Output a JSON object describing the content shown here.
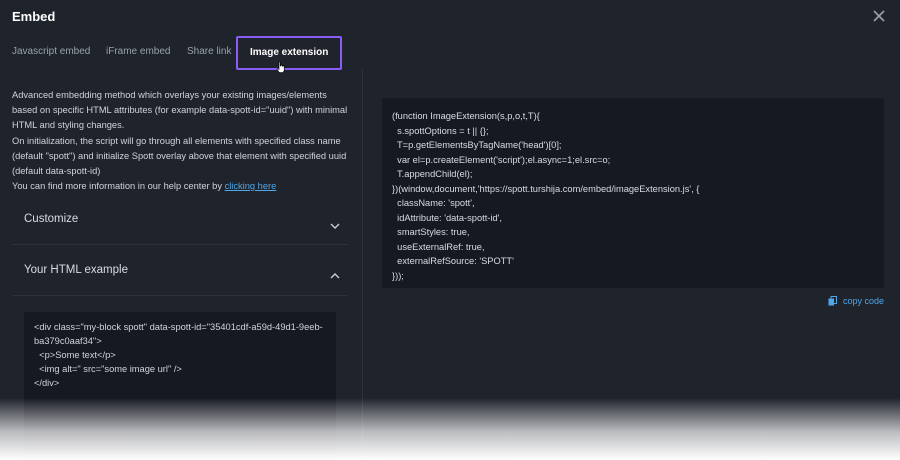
{
  "dialog": {
    "title": "Embed"
  },
  "tabs": [
    {
      "label": "Javascript embed"
    },
    {
      "label": "iFrame embed"
    },
    {
      "label": "Share link"
    },
    {
      "label": "Image extension"
    }
  ],
  "description": {
    "p1": "Advanced embedding method which overlays your existing images/elements based on specific HTML attributes (for example data-spott-id=\"uuid\") with minimal HTML and styling changes.",
    "p2": "On initialization, the script will go through all elements with specified class name (default \"spott\") and initialize Spott overlay above that element with specified uuid (default data-spott-id)",
    "p3_prefix": "You can find more information in our help center by",
    "p3_link": "clicking here"
  },
  "sections": {
    "customize": "Customize",
    "html_example": "Your HTML example"
  },
  "html_example_code": "<div class=\"my-block spott\" data-spott-id=\"35401cdf-a59d-49d1-9eeb-ba379c0aaf34\">\n  <p>Some text</p>\n  <img alt=\" src=\"some image url\" />\n</div>",
  "script_code": "(function ImageExtension(s,p,o,t,T){\n  s.spottOptions = t || {};\n  T=p.getElementsByTagName('head')[0];\n  var el=p.createElement('script');el.async=1;el.src=o;\n  T.appendChild(el);\n})(window,document,'https://spott.turshija.com/embed/imageExtension.js', {\n  className: 'spott',\n  idAttribute: 'data-spott-id',\n  smartStyles: true,\n  useExternalRef: true,\n  externalRefSource: 'SPOTT'\n}));",
  "copy_label": "copy code",
  "colors": {
    "accent": "#8a5cf6",
    "link": "#4fa6e8",
    "background": "#1f232c",
    "code_background": "#161922"
  }
}
